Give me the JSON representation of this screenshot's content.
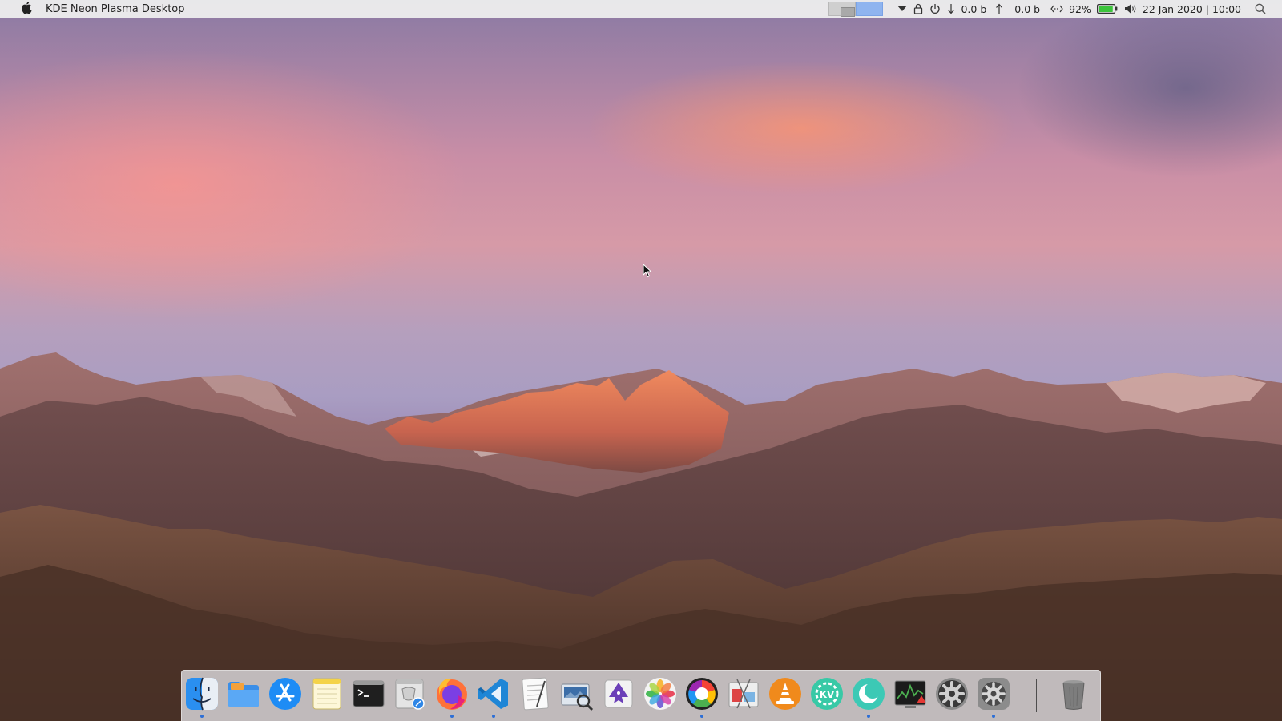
{
  "top_panel": {
    "app_title": "KDE Neon Plasma Desktop",
    "pager": {
      "desktops": 2,
      "active_desktop": 2
    },
    "tray": {
      "net_down": "0.0 b",
      "net_up": "0.0 b",
      "battery_percent": "92%",
      "battery_level": 0.92,
      "datetime": "22 Jan 2020 | 10:00"
    },
    "icons": [
      "apple-icon",
      "dropdown-arrow-icon",
      "lock-icon",
      "power-icon",
      "download-arrow-icon",
      "upload-arrow-icon",
      "network-icon",
      "battery-icon",
      "volume-icon",
      "search-icon"
    ]
  },
  "dock": {
    "items": [
      {
        "name": "finder",
        "running": true
      },
      {
        "name": "file-manager",
        "running": false
      },
      {
        "name": "app-store",
        "running": false
      },
      {
        "name": "notes",
        "running": false
      },
      {
        "name": "terminal",
        "running": false
      },
      {
        "name": "preview",
        "running": false
      },
      {
        "name": "firefox",
        "running": true
      },
      {
        "name": "vscode",
        "running": true
      },
      {
        "name": "text-editor",
        "running": false
      },
      {
        "name": "image-viewer",
        "running": false
      },
      {
        "name": "inkscape",
        "running": false
      },
      {
        "name": "photos",
        "running": false
      },
      {
        "name": "color-picker",
        "running": true
      },
      {
        "name": "screenshot-tool",
        "running": false
      },
      {
        "name": "vlc",
        "running": false
      },
      {
        "name": "kvantum",
        "running": false
      },
      {
        "name": "night-mode",
        "running": true
      },
      {
        "name": "system-monitor",
        "running": false
      },
      {
        "name": "settings",
        "running": false
      },
      {
        "name": "system-preferences",
        "running": true
      },
      {
        "name": "trash",
        "running": false
      }
    ]
  },
  "colors": {
    "accent": "#2d6fd6",
    "panel_bg": "#ececec",
    "battery_fill": "#3cc43c"
  }
}
